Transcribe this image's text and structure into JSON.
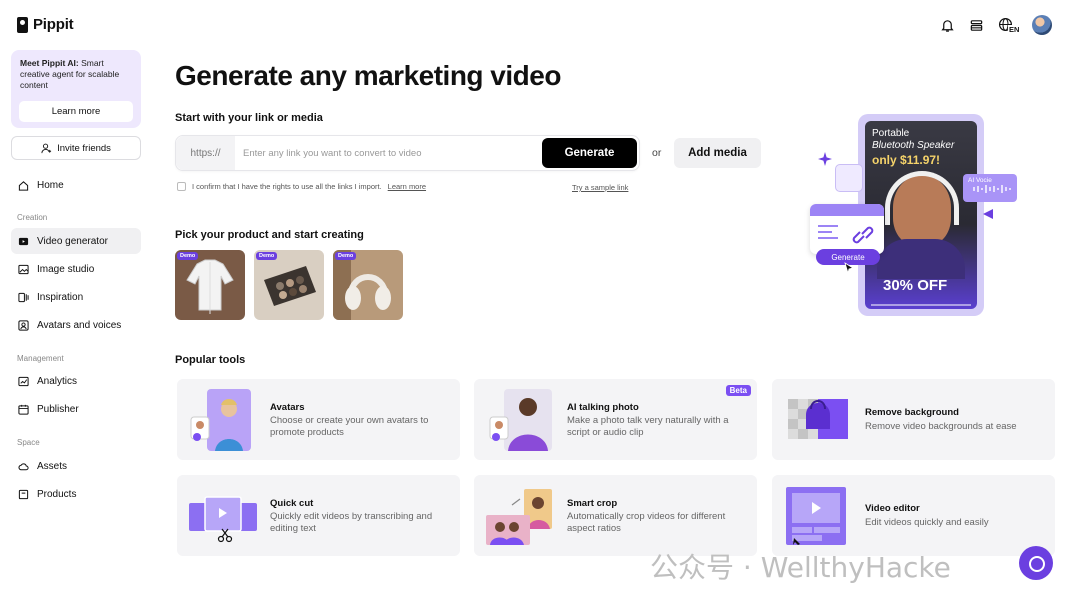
{
  "brand": {
    "name": "Pippit"
  },
  "sidebar": {
    "promo": {
      "title": "Meet Pippit AI:",
      "text": " Smart creative agent for scalable content",
      "button": "Learn more"
    },
    "invite": "Invite friends",
    "home": "Home",
    "sections": {
      "creation": "Creation",
      "management": "Management",
      "space": "Space"
    },
    "creation_items": [
      "Video generator",
      "Image studio",
      "Inspiration",
      "Avatars and voices"
    ],
    "management_items": [
      "Analytics",
      "Publisher"
    ],
    "space_items": [
      "Assets",
      "Products"
    ],
    "active_item": "Video generator"
  },
  "header": {
    "language": "EN"
  },
  "main": {
    "headline": "Generate any marketing video",
    "start_label": "Start with your link or media",
    "link_prefix": "https://",
    "link_placeholder": "Enter any link you want to convert to video",
    "generate_button": "Generate",
    "or": "or",
    "add_media": "Add media",
    "rights_text": "I confirm that I have the rights to use all the links I import.",
    "rights_link": "Learn more",
    "sample_link": "Try a sample link",
    "pick_label": "Pick your product and start creating",
    "products": [
      {
        "tag": "Demo",
        "name": "white shirt"
      },
      {
        "tag": "Demo",
        "name": "eyeshadow palette"
      },
      {
        "tag": "Demo",
        "name": "headphones"
      }
    ],
    "tools_label": "Popular tools",
    "tools": [
      {
        "title": "Avatars",
        "desc": "Choose or create your own avatars to promote products",
        "badge": ""
      },
      {
        "title": "AI talking photo",
        "desc": "Make a photo talk very naturally with a script or audio clip",
        "badge": "Beta"
      },
      {
        "title": "Remove background",
        "desc": "Remove video backgrounds at ease",
        "badge": ""
      },
      {
        "title": "Quick cut",
        "desc": "Quickly edit videos by transcribing and editing text",
        "badge": ""
      },
      {
        "title": "Smart crop",
        "desc": "Automatically crop videos for different aspect ratios",
        "badge": ""
      },
      {
        "title": "Video editor",
        "desc": "Edit videos quickly and easily",
        "badge": ""
      }
    ]
  },
  "hero": {
    "ad_line1": "Portable",
    "ad_line2": "Bluetooth Speaker",
    "ad_price": "only $11.97!",
    "ad_discount": "30% OFF",
    "generate_pill": "Generate",
    "voice_label": "AI Vocie"
  },
  "watermark": "公众号 · WellthyHacke",
  "colors": {
    "accent": "#6b3fe0",
    "promo_bg": "#eee8fd",
    "tool_bg": "#f4f4f6"
  }
}
